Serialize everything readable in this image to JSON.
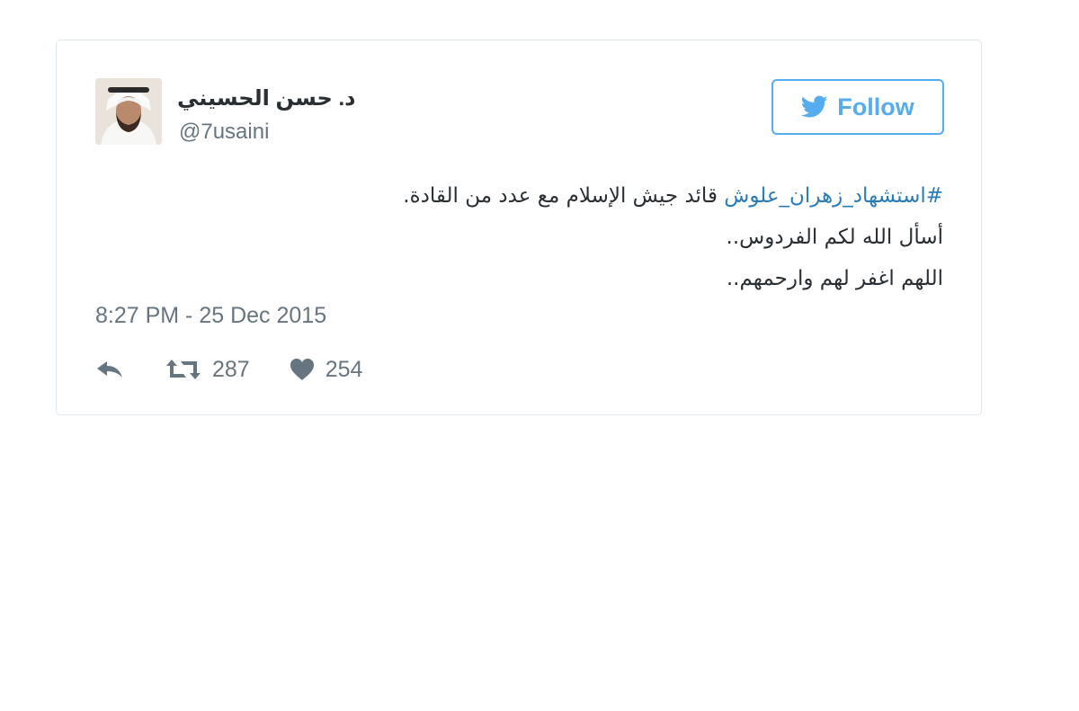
{
  "tweet": {
    "author": {
      "display_name": "د. حسن الحسيني",
      "handle": "@7usaini",
      "avatar_icon": "profile-photo"
    },
    "follow_button": {
      "label": "Follow",
      "icon": "twitter-bird-icon",
      "color": "#55acee"
    },
    "text": {
      "line1_hashtag": "#استشهاد_زهران_علوش",
      "line1_rest": " قائد جيش الإسلام مع عدد من القادة.",
      "line2": "أسأل الله لكم الفردوس..",
      "line3": "اللهم اغفر لهم وارحمهم.."
    },
    "timestamp": "8:27 PM - 25 Dec 2015",
    "actions": {
      "reply_icon": "reply-icon",
      "retweet_icon": "retweet-icon",
      "retweet_count": "287",
      "like_icon": "heart-icon",
      "like_count": "254"
    },
    "colors": {
      "link": "#2b7bb9",
      "secondary_text": "#66757f",
      "border": "#e1e8ed"
    }
  }
}
